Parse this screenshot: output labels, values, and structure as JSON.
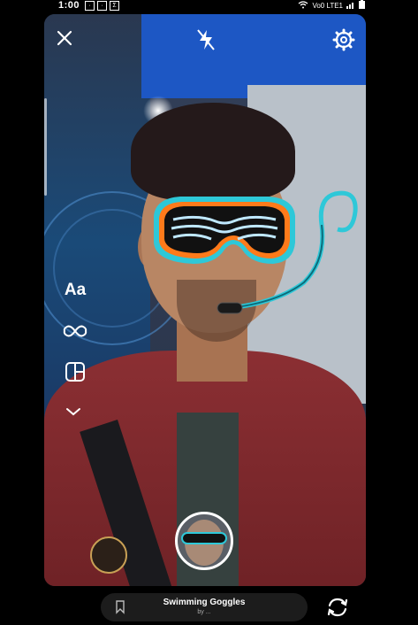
{
  "status_bar": {
    "time": "1:00",
    "network": "Vo0 LTE1"
  },
  "camera_overlay": {
    "close_icon": "close-icon",
    "flash_icon": "flash-off-icon",
    "settings_icon": "gear-icon",
    "tools": {
      "text_label": "Aa",
      "boomerang_icon": "infinity-icon",
      "layout_icon": "layout-icon",
      "more_icon": "chevron-down-icon"
    }
  },
  "effect": {
    "name": "Swimming Goggles",
    "author": "by ...",
    "save_icon": "bookmark-icon"
  },
  "bottom": {
    "flip_icon": "flip-camera-icon"
  },
  "colors": {
    "goggle_outline": "#2ec8d8",
    "goggle_inner": "#ff7a1a",
    "goggle_lens": "#111111",
    "lens_stripes": "#bfe8ff"
  }
}
